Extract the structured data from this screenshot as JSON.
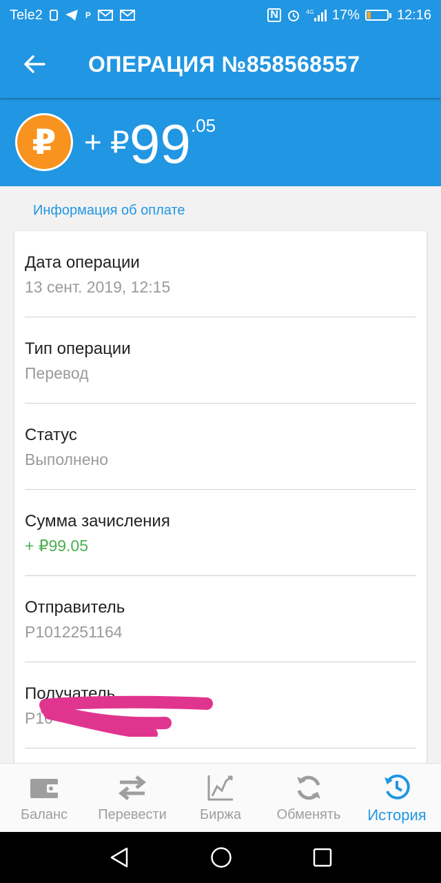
{
  "status_bar": {
    "carrier": "Tele2",
    "battery": "17%",
    "battery_level": 0.17,
    "time": "12:16"
  },
  "app_bar": {
    "title": "ОПЕРАЦИЯ №858568557"
  },
  "amount": {
    "sign": "+ ₽",
    "main": "99",
    "cents": ".05",
    "icon": "ruble-coin-icon"
  },
  "section": {
    "title": "Информация об оплате"
  },
  "details": [
    {
      "label": "Дата операции",
      "value": "13 сент. 2019, 12:15"
    },
    {
      "label": "Тип операции",
      "value": "Перевод"
    },
    {
      "label": "Статус",
      "value": "Выполнено"
    },
    {
      "label": "Сумма зачисления",
      "value": "+ ₽99.05"
    },
    {
      "label": "Отправитель",
      "value": "P1012251164"
    },
    {
      "label": "Получатель",
      "value": "P10"
    }
  ],
  "colors": {
    "primary": "#2196e3",
    "coin": "#f7931e",
    "positive": "#4caf50",
    "redaction": "#e0358f"
  },
  "bottom_nav": {
    "items": [
      {
        "label": "Баланс",
        "icon": "wallet-icon"
      },
      {
        "label": "Перевести",
        "icon": "transfer-arrows-icon"
      },
      {
        "label": "Биржа",
        "icon": "chart-icon"
      },
      {
        "label": "Обменять",
        "icon": "refresh-icon"
      },
      {
        "label": "История",
        "icon": "history-icon",
        "active": true
      }
    ]
  }
}
